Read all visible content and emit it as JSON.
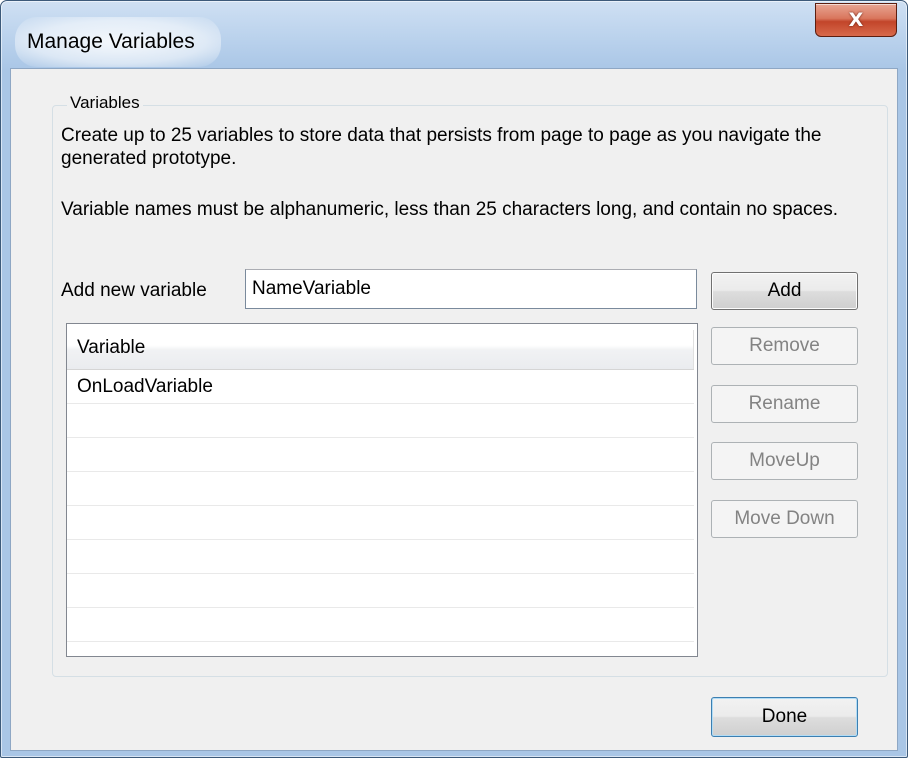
{
  "window": {
    "title": "Manage Variables",
    "close_glyph": "X"
  },
  "group": {
    "legend": "Variables",
    "description_1": "Create up to 25 variables to store data that persists from page to page as you navigate the generated prototype.",
    "description_2": "Variable names must be alphanumeric, less than 25 characters long, and contain no spaces."
  },
  "add_variable": {
    "label": "Add new variable",
    "value": "NameVariable"
  },
  "buttons": {
    "add": "Add",
    "remove": "Remove",
    "rename": "Rename",
    "move_up": "MoveUp",
    "move_down": "Move Down",
    "done": "Done"
  },
  "variables_list": {
    "column_header": "Variable",
    "rows": [
      "OnLoadVariable",
      "",
      "",
      "",
      "",
      "",
      "",
      ""
    ]
  },
  "icons": {
    "close": "close-icon"
  }
}
